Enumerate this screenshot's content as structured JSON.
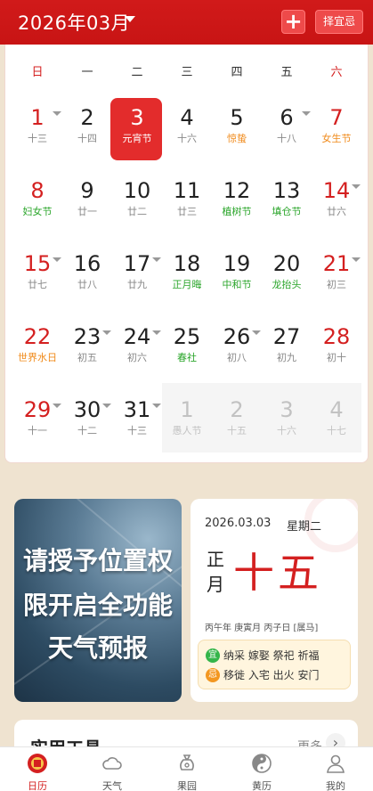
{
  "header": {
    "month": "2026年03月",
    "add_label": "+",
    "pick_label": "择宜忌"
  },
  "weekdays": [
    "日",
    "一",
    "二",
    "三",
    "四",
    "五",
    "六"
  ],
  "weeks": [
    [
      {
        "n": "1",
        "s": "十三",
        "tri": true,
        "weekend": true
      },
      {
        "n": "2",
        "s": "十四"
      },
      {
        "n": "3",
        "s": "元宵节",
        "today": true
      },
      {
        "n": "4",
        "s": "十六"
      },
      {
        "n": "5",
        "s": "惊蛰",
        "tone": "orange"
      },
      {
        "n": "6",
        "s": "十八",
        "tri": true
      },
      {
        "n": "7",
        "s": "女生节",
        "tone": "orange",
        "weekend": true
      }
    ],
    [
      {
        "n": "8",
        "s": "妇女节",
        "tone": "green",
        "weekend": true
      },
      {
        "n": "9",
        "s": "廿一"
      },
      {
        "n": "10",
        "s": "廿二"
      },
      {
        "n": "11",
        "s": "廿三"
      },
      {
        "n": "12",
        "s": "植树节",
        "tone": "green"
      },
      {
        "n": "13",
        "s": "填仓节",
        "tone": "green"
      },
      {
        "n": "14",
        "s": "廿六",
        "tri": true,
        "weekend": true
      }
    ],
    [
      {
        "n": "15",
        "s": "廿七",
        "tri": true,
        "weekend": true
      },
      {
        "n": "16",
        "s": "廿八"
      },
      {
        "n": "17",
        "s": "廿九",
        "tri": true
      },
      {
        "n": "18",
        "s": "正月晦",
        "tone": "green"
      },
      {
        "n": "19",
        "s": "中和节",
        "tone": "green"
      },
      {
        "n": "20",
        "s": "龙抬头",
        "tone": "green"
      },
      {
        "n": "21",
        "s": "初三",
        "tri": true,
        "weekend": true
      }
    ],
    [
      {
        "n": "22",
        "s": "世界水日",
        "tone": "orange",
        "weekend": true
      },
      {
        "n": "23",
        "s": "初五",
        "tri": true
      },
      {
        "n": "24",
        "s": "初六",
        "tri": true
      },
      {
        "n": "25",
        "s": "春社",
        "tone": "green"
      },
      {
        "n": "26",
        "s": "初八",
        "tri": true
      },
      {
        "n": "27",
        "s": "初九"
      },
      {
        "n": "28",
        "s": "初十",
        "weekend": true
      }
    ],
    [
      {
        "n": "29",
        "s": "十一",
        "tri": true,
        "weekend": true
      },
      {
        "n": "30",
        "s": "十二",
        "tri": true
      },
      {
        "n": "31",
        "s": "十三",
        "tri": true
      },
      {
        "n": "1",
        "s": "愚人节",
        "other": true
      },
      {
        "n": "2",
        "s": "十五",
        "other": true
      },
      {
        "n": "3",
        "s": "十六",
        "other": true
      },
      {
        "n": "4",
        "s": "十七",
        "other": true
      }
    ]
  ],
  "ad": {
    "lines": [
      "请授予位置权",
      "限开启全功能",
      "天气预报"
    ]
  },
  "almanac": {
    "date": "2026.03.03",
    "weekday": "星期二",
    "lunar_month": "正月",
    "lunar_day": "十五",
    "ganzhi": "丙午年 庚寅月 丙子日 [属马]",
    "yi_badge": "宜",
    "yi": "纳采 嫁娶 祭祀 祈福",
    "ji_badge": "忌",
    "ji": "移徙 入宅 出火 安门"
  },
  "tools": {
    "title": "实用工具",
    "more": "更多",
    "arrow": "›"
  },
  "tabs": [
    {
      "label": "日历",
      "icon": "calendar-icon",
      "active": true
    },
    {
      "label": "天气",
      "icon": "cloud-icon"
    },
    {
      "label": "果园",
      "icon": "money-bag-icon"
    },
    {
      "label": "黄历",
      "icon": "yin-yang-icon"
    },
    {
      "label": "我的",
      "icon": "person-icon"
    }
  ]
}
